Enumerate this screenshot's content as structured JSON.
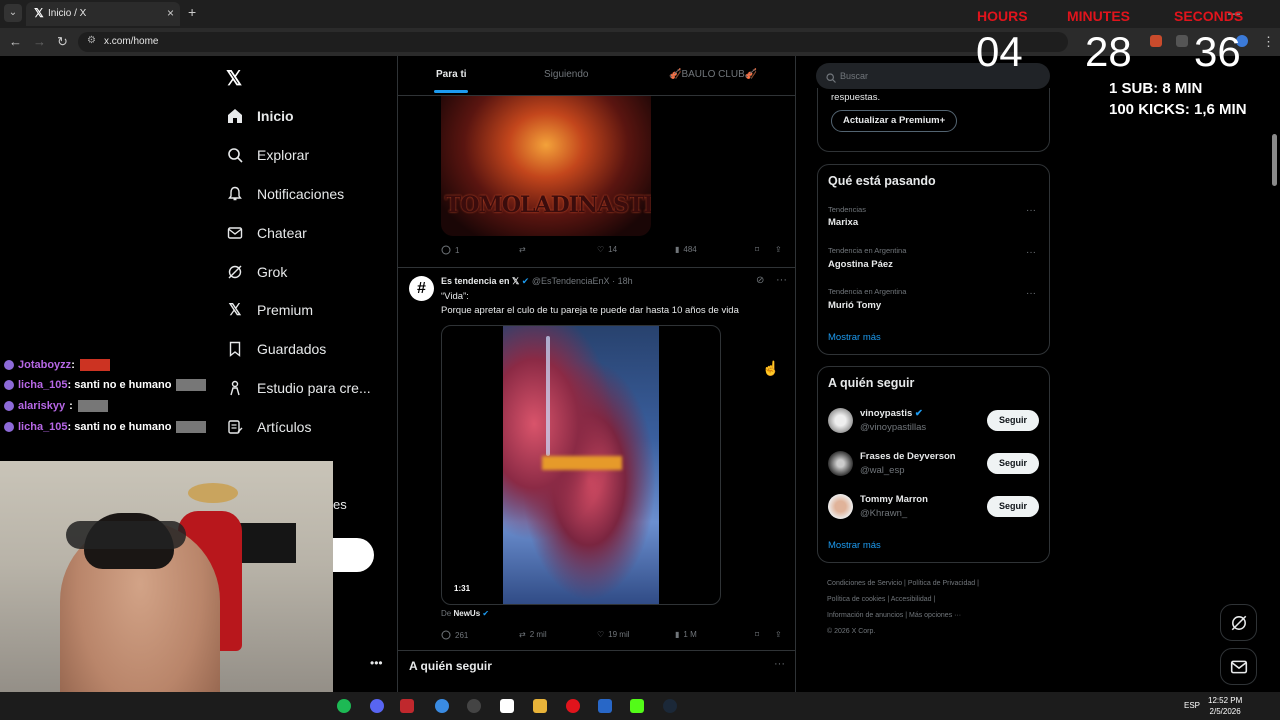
{
  "browser": {
    "tab_title": "Inicio / X",
    "url": "x.com/home"
  },
  "nav": {
    "items": [
      {
        "label": "Inicio",
        "icon": "home-icon"
      },
      {
        "label": "Explorar",
        "icon": "search-icon"
      },
      {
        "label": "Notificaciones",
        "icon": "bell-icon"
      },
      {
        "label": "Chatear",
        "icon": "mail-icon"
      },
      {
        "label": "Grok",
        "icon": "grok-icon"
      },
      {
        "label": "Premium",
        "icon": "x-logo-icon"
      },
      {
        "label": "Guardados",
        "icon": "bookmark-icon"
      },
      {
        "label": "Estudio para cre...",
        "icon": "creator-studio-icon"
      },
      {
        "label": "Artículos",
        "icon": "articles-icon"
      }
    ],
    "partial_label": "es"
  },
  "feed": {
    "tabs": [
      "Para ti",
      "Siguiendo",
      "🎻BAULO CLUB🎻"
    ],
    "prev_post": {
      "image_text": "TOMOLADINASTIA",
      "replies": "1",
      "likes": "14",
      "views": "484"
    },
    "post": {
      "name": "Es tendencia en 𝕏",
      "handle": "@EsTendenciaEnX",
      "time": "18h",
      "text_line1": "“Vida”:",
      "text_line2": "Porque apretar el culo de tu pareja te puede dar hasta 10 años de vida",
      "video_duration": "1:31",
      "from_prefix": "De",
      "from_account": "NewUs",
      "replies": "261",
      "reposts": "2 mil",
      "likes": "19 mil",
      "views": "1 M"
    },
    "who_to_follow": "A quién seguir"
  },
  "right": {
    "search_placeholder": "Buscar",
    "premium_text": "respuestas.",
    "premium_button": "Actualizar a Premium+",
    "trends_title": "Qué está pasando",
    "trends": [
      {
        "category": "Tendencias",
        "name": "Marixa"
      },
      {
        "category": "Tendencia en Argentina",
        "name": "Agostina Páez"
      },
      {
        "category": "Tendencia en Argentina",
        "name": "Murió Tomy"
      }
    ],
    "show_more": "Mostrar más",
    "wtf_title": "A quién seguir",
    "follow": [
      {
        "name": "vinoypastis",
        "handle": "@vinoypastillas"
      },
      {
        "name": "Frases de Deyverson",
        "handle": "@wal_esp"
      },
      {
        "name": "Tommy Marron",
        "handle": "@Khrawn_"
      }
    ],
    "follow_button": "Seguir",
    "footer": [
      "Condiciones de Servicio",
      "Política de Privacidad",
      "Política de cookies",
      "Accesibilidad",
      "Información de anuncios",
      "Más opciones ···",
      "© 2026 X Corp."
    ]
  },
  "overlay": {
    "labels": [
      "HOURS",
      "MINUTES",
      "SECONDS"
    ],
    "hours": "04",
    "minutes": "28",
    "seconds": "36",
    "rule1": "1 SUB: 8 MIN",
    "rule2": "100 KICKS: 1,6 MIN",
    "chat": [
      {
        "user": "Jotaboyzz",
        "msg": ":"
      },
      {
        "user": "licha_105",
        "msg": ": santi no e humano"
      },
      {
        "user": "alariskyy",
        "msg": ":"
      },
      {
        "user": "licha_105",
        "msg": ": santi no e humano"
      }
    ]
  },
  "taskbar": {
    "lang": "ESP",
    "time": "12:52 PM",
    "date": "2/5/2026"
  },
  "colors": {
    "accent": "#1d9bf0",
    "timer_label": "#e0141c",
    "chat_user": "#b667e5"
  }
}
